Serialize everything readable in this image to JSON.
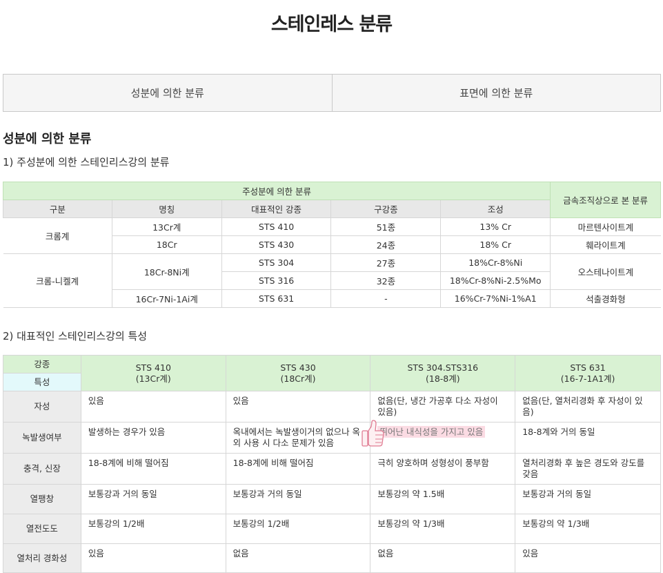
{
  "page": {
    "title": "스테인레스 분류",
    "tabs": [
      "성분에 의한 분류",
      "표면에 의한 분류"
    ],
    "section_title": "성분에 의한 분류",
    "sub1": "1) 주성분에 의한 스테인리스강의 분류",
    "sub2": "2) 대표적인 스테인리스강의 특성"
  },
  "table1": {
    "group_header": "주성분에 의한 분류",
    "side_header": "금속조직상으로 본 분류",
    "headers": [
      "구분",
      "명칭",
      "대표적인 강종",
      "구강종",
      "조성"
    ],
    "cat_chrome": "크롬계",
    "cat_chrome_nickel": "크롬-니켈계",
    "rows": [
      {
        "name": "13Cr계",
        "steel": "STS 410",
        "count": "51종",
        "comp": "13% Cr",
        "struct": "마르텐사이트계"
      },
      {
        "name": "18Cr",
        "steel": "STS 430",
        "count": "24종",
        "comp": "18% Cr",
        "struct": "훼라이트계"
      },
      {
        "name": "18Cr-8Ni계",
        "steel": "STS 304",
        "count": "27종",
        "comp": "18%Cr-8%Ni",
        "struct": "오스테나이트계"
      },
      {
        "steel": "STS 316",
        "count": "32종",
        "comp": "18%Cr-8%Ni-2.5%Mo"
      },
      {
        "name": "16Cr-7Ni-1Ai계",
        "steel": "STS 631",
        "count": "-",
        "comp": "16%Cr-7%Ni-1%A1",
        "struct": "석출경화형"
      }
    ]
  },
  "table2": {
    "corner_top": "강종",
    "corner_bottom": "특성",
    "columns": [
      {
        "l1": "STS 410",
        "l2": "(13Cr계)"
      },
      {
        "l1": "STS 430",
        "l2": "(18Cr계)"
      },
      {
        "l1": "STS 304.STS316",
        "l2": "(18-8계)"
      },
      {
        "l1": "STS 631",
        "l2": "(16-7-1A1계)"
      }
    ],
    "rows": [
      {
        "label": "자성",
        "cells": [
          "있음",
          "있음",
          "없음(단, 냉간 가공후 다소 자성이 있음)",
          "없음(단, 열처리경화 후 자성이 있음)"
        ]
      },
      {
        "label": "녹발생여부",
        "cells": [
          "발생하는 경우가 있음",
          "옥내에서는 녹발생이거의 없으나 옥외 사용 시 다소 문제가 있음",
          "뛰어난 내식성을 가지고 있음",
          "18-8계와 거의 동일"
        ]
      },
      {
        "label": "충격, 신장",
        "cells": [
          "18-8계에 비해 떨어짐",
          "18-8계에 비해 떨어짐",
          "극히 양호하며 성형성이 풍부함",
          "열처리경화 후 높은 경도와 강도를 갖음"
        ]
      },
      {
        "label": "열팽창",
        "cells": [
          "보통강과 거의 동일",
          "보통강과 거의 동일",
          "보통강의 약 1.5배",
          "보통강과 거의 동일"
        ]
      },
      {
        "label": "열전도도",
        "cells": [
          "보통강의 1/2배",
          "보통강의 1/2배",
          "보통강의 약 1/3배",
          "보통강의 약 1/3배"
        ]
      },
      {
        "label": "열처리 경화성",
        "cells": [
          "있음",
          "없음",
          "없음",
          "있음"
        ]
      }
    ]
  }
}
